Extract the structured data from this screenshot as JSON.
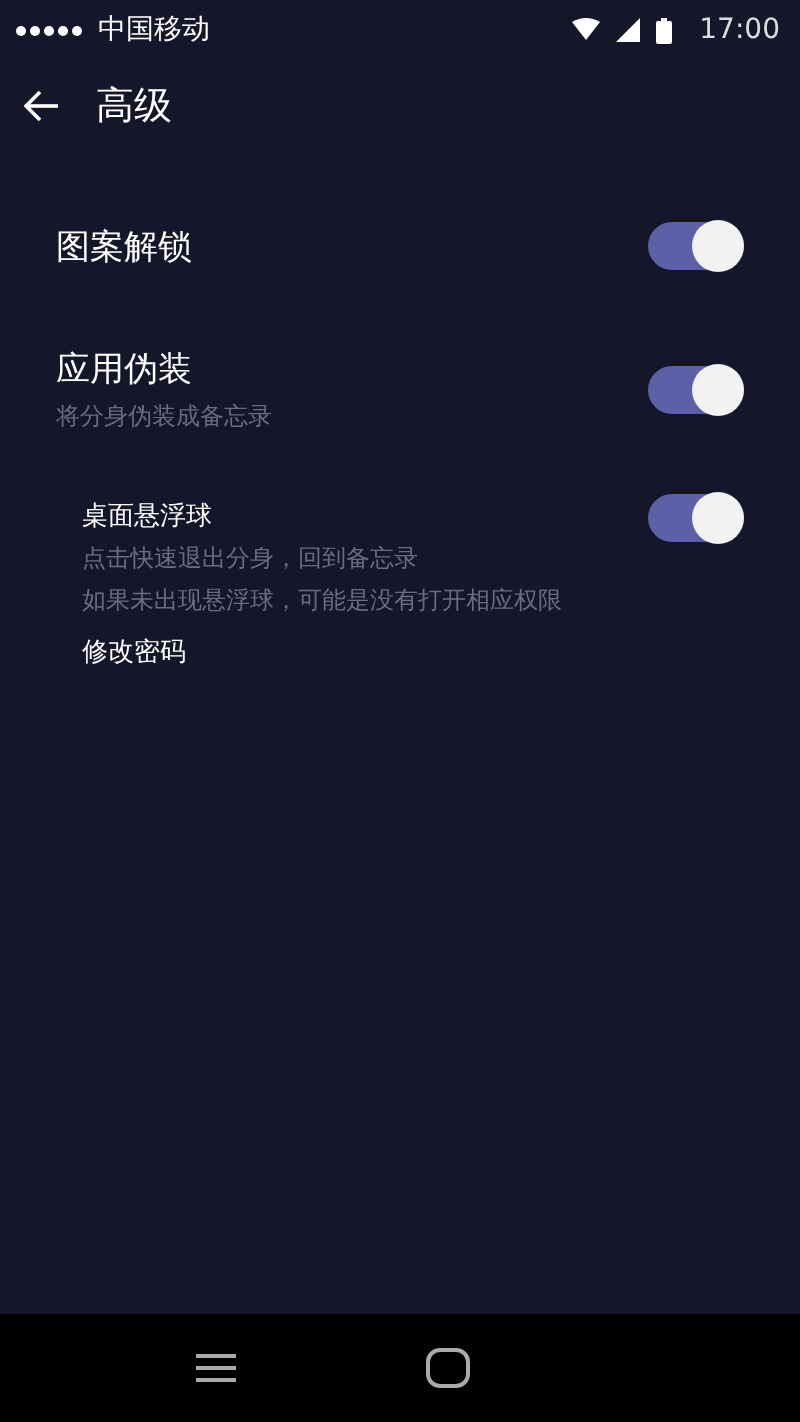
{
  "status_bar": {
    "carrier": "中国移动",
    "time": "17:00"
  },
  "header": {
    "title": "高级"
  },
  "settings": [
    {
      "kind": "toggle",
      "title": "图案解锁",
      "on": true,
      "nested": false
    },
    {
      "kind": "toggle",
      "title": "应用伪装",
      "subtitles": [
        "将分身伪装成备忘录"
      ],
      "on": true,
      "nested": false
    },
    {
      "kind": "toggle",
      "title": "桌面悬浮球",
      "subtitles": [
        "点击快速退出分身，回到备忘录",
        "如果未出现悬浮球，可能是没有打开相应权限"
      ],
      "on": true,
      "nested": true
    },
    {
      "kind": "link",
      "title": "修改密码",
      "nested": true
    }
  ]
}
